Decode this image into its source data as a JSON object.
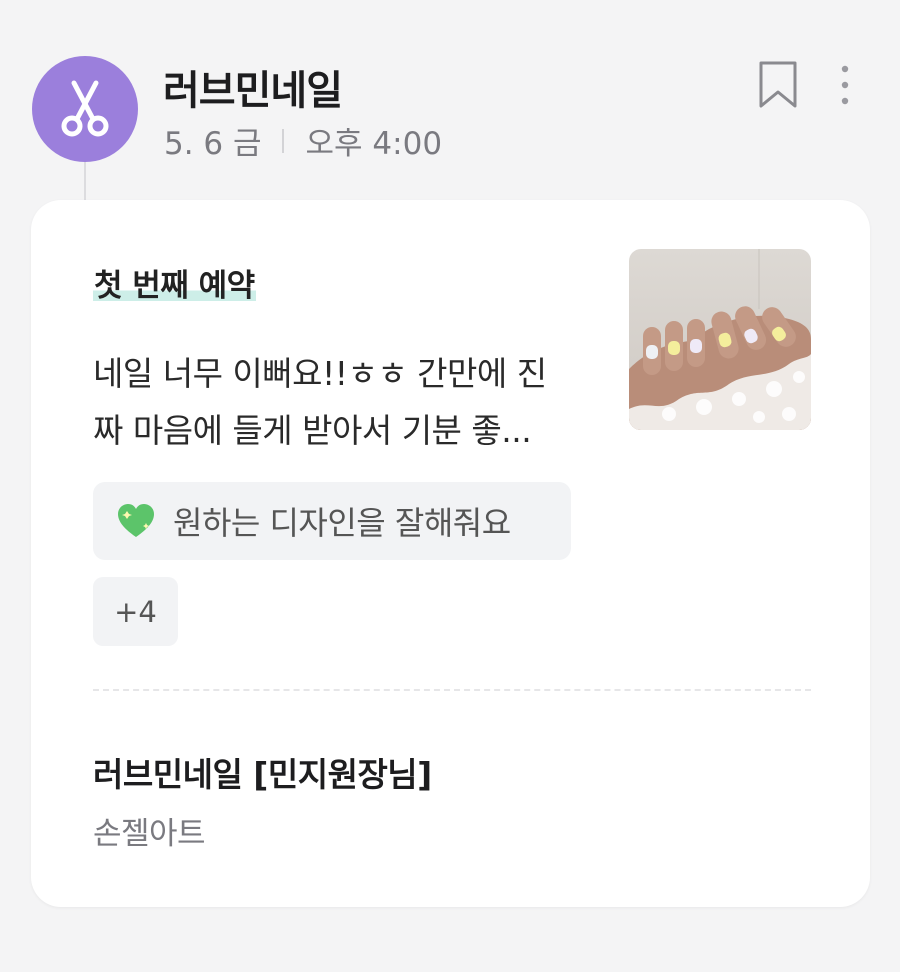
{
  "header": {
    "shop_name": "러브민네일",
    "date": "5. 6 금",
    "time": "오후 4:00",
    "avatar_icon": "scissors-icon",
    "avatar_color": "#9b7fdc"
  },
  "actions": {
    "bookmark_icon": "bookmark-icon",
    "more_icon": "more-vertical-icon"
  },
  "review": {
    "title": "첫 번째 예약",
    "text_line1": "네일 너무 이뻐요!!ㅎㅎ 간만에 진",
    "text_line2": "짜 마음에 들게 받아서 기분 좋...",
    "photo_icon": "nail-photo",
    "tag_icon": "green-heart-icon",
    "tag_label": "원하는 디자인을 잘해줘요",
    "more_tags": "+4"
  },
  "footer": {
    "designer": "러브민네일 [민지원장님]",
    "service": "손젤아트"
  }
}
